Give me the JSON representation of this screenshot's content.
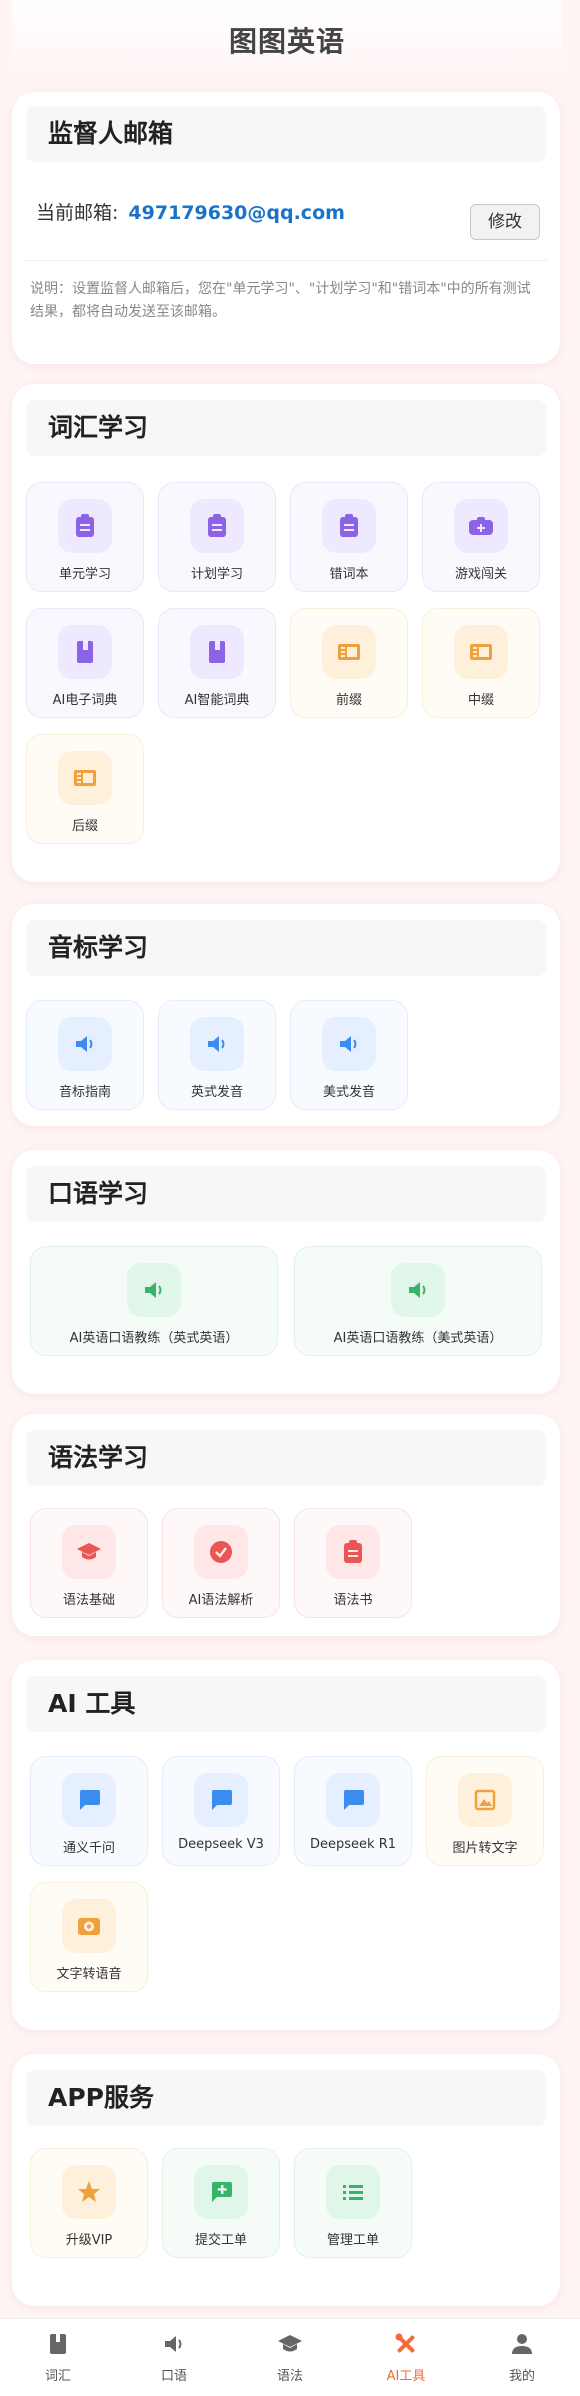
{
  "app": {
    "title": "图图英语"
  },
  "supervisor": {
    "title": "监督人邮箱",
    "current_label": "当前邮箱:",
    "email": "497179630@qq.com",
    "edit_label": "修改",
    "note": "说明：设置监督人邮箱后，您在\"单元学习\"、\"计划学习\"和\"错词本\"中的所有测试结果，都将自动发送至该邮箱。"
  },
  "vocab": {
    "title": "词汇学习",
    "items": [
      {
        "label": "单元学习",
        "icon": "clipboard-icon"
      },
      {
        "label": "计划学习",
        "icon": "clipboard-icon"
      },
      {
        "label": "错词本",
        "icon": "clipboard-icon"
      },
      {
        "label": "游戏闯关",
        "icon": "gamepad-icon"
      },
      {
        "label": "AI电子词典",
        "icon": "book-icon"
      },
      {
        "label": "AI智能词典",
        "icon": "book-icon"
      },
      {
        "label": "前缀",
        "icon": "panel-icon"
      },
      {
        "label": "中缀",
        "icon": "panel-icon"
      },
      {
        "label": "后缀",
        "icon": "panel-icon"
      }
    ]
  },
  "phonetic": {
    "title": "音标学习",
    "items": [
      {
        "label": "音标指南",
        "icon": "speaker-icon"
      },
      {
        "label": "英式发音",
        "icon": "speaker-icon"
      },
      {
        "label": "美式发音",
        "icon": "speaker-icon"
      }
    ]
  },
  "speaking": {
    "title": "口语学习",
    "items": [
      {
        "label": "AI英语口语教练（英式英语）",
        "icon": "speaker-icon"
      },
      {
        "label": "AI英语口语教练（美式英语）",
        "icon": "speaker-icon"
      }
    ]
  },
  "grammar": {
    "title": "语法学习",
    "items": [
      {
        "label": "语法基础",
        "icon": "graduation-cap-icon"
      },
      {
        "label": "AI语法解析",
        "icon": "check-circle-icon"
      },
      {
        "label": "语法书",
        "icon": "clipboard-icon"
      }
    ]
  },
  "ai_tools": {
    "title": "AI 工具",
    "items": [
      {
        "label": "通义千问",
        "icon": "chat-icon"
      },
      {
        "label": "Deepseek V3",
        "icon": "chat-icon"
      },
      {
        "label": "Deepseek R1",
        "icon": "chat-icon"
      },
      {
        "label": "图片转文字",
        "icon": "image-icon"
      },
      {
        "label": "文字转语音",
        "icon": "audio-icon"
      }
    ]
  },
  "app_service": {
    "title": "APP服务",
    "items": [
      {
        "label": "升级VIP",
        "icon": "star-icon"
      },
      {
        "label": "提交工单",
        "icon": "add-comment-icon"
      },
      {
        "label": "管理工单",
        "icon": "list-icon"
      }
    ]
  },
  "tabbar": {
    "active": "AI工具",
    "items": [
      {
        "label": "词汇",
        "icon": "book-icon"
      },
      {
        "label": "口语",
        "icon": "speaker-icon"
      },
      {
        "label": "语法",
        "icon": "graduation-cap-icon"
      },
      {
        "label": "AI工具",
        "icon": "tools-icon"
      },
      {
        "label": "我的",
        "icon": "user-icon"
      }
    ]
  },
  "colors": {
    "accent": "#f26b3a",
    "email": "#1a73c8",
    "purple": "#8b62e8",
    "orange": "#f0a03c",
    "blue": "#3b8cf0",
    "green": "#36b46a",
    "red": "#ea5555"
  }
}
